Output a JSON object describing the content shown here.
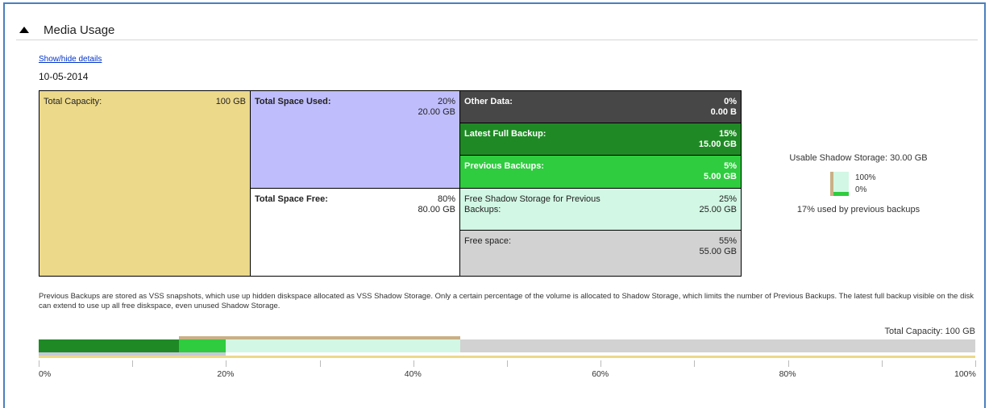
{
  "header": {
    "title": "Media Usage"
  },
  "show_hide": "Show/hide details",
  "date": "10-05-2014",
  "table": {
    "total_capacity": {
      "label": "Total Capacity:",
      "value": "100 GB"
    },
    "total_used": {
      "label": "Total Space Used:",
      "pct": "20%",
      "value": "20.00 GB"
    },
    "total_free": {
      "label": "Total Space Free:",
      "pct": "80%",
      "value": "80.00 GB"
    },
    "other_data": {
      "label": "Other Data:",
      "pct": "0%",
      "value": "0.00 B"
    },
    "latest_full": {
      "label": "Latest Full Backup:",
      "pct": "15%",
      "value": "15.00 GB"
    },
    "previous": {
      "label": "Previous Backups:",
      "pct": "5%",
      "value": "5.00 GB"
    },
    "free_shadow": {
      "label_line1": "Free Shadow Storage for Previous",
      "label_line2": "Backups:",
      "pct": "25%",
      "value": "25.00 GB"
    },
    "free_space": {
      "label": "Free space:",
      "pct": "55%",
      "value": "55.00 GB"
    }
  },
  "shadow": {
    "usable": "Usable Shadow Storage: 30.00 GB",
    "top_pct": "100%",
    "bottom_pct": "0%",
    "used_text": "17% used by previous backups",
    "used_fraction": 0.17
  },
  "note": "Previous Backups are stored as VSS snapshots, which use up hidden diskspace allocated as VSS Shadow Storage. Only a certain percentage of the volume is allocated to Shadow Storage, which limits the number of Previous Backups. The latest full backup visible on the disk can extend to use up all free diskspace, even unused Shadow Storage.",
  "total_capacity_label": "Total Capacity: 100 GB",
  "bar": {
    "segments_pct": {
      "latest_full": 15,
      "previous": 5,
      "free_shadow": 25,
      "free_space": 55
    },
    "shadow_span_pct": [
      15,
      45
    ],
    "used_pct": 20
  },
  "axis_labels": [
    "0%",
    "20%",
    "40%",
    "60%",
    "80%",
    "100%"
  ],
  "colors": {
    "capacity": "#ecd98a",
    "used": "#bfbdfb",
    "other": "#474747",
    "latest": "#1f8a25",
    "previous": "#2ecc3e",
    "free_shadow": "#d2f7e4",
    "free_space": "#d2d2d2",
    "shadow_line": "#c9b085"
  }
}
